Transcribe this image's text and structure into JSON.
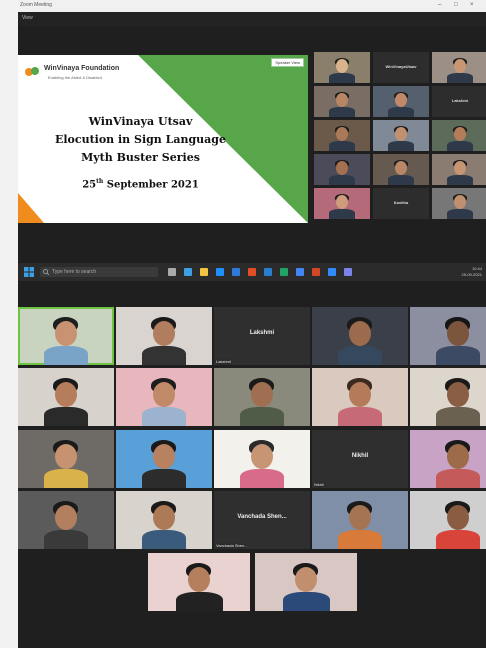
{
  "window": {
    "title": "Zoom Meeting"
  },
  "meeting_bar": {
    "label": "View"
  },
  "slide": {
    "logo": "WinVinaya Foundation",
    "logo_sub": "Enabling the Abled & Disabled",
    "tag": "Speaker View",
    "title_line1": "WinVinaya Utsav",
    "title_line2": "Elocution in Sign Language",
    "title_line3": "Myth Buster Series",
    "date_day": "25",
    "date_suffix": "th",
    "date_rest": " September 2021"
  },
  "mini_gallery": [
    {
      "label": "",
      "name": ""
    },
    {
      "label": "WinVinayaUtsav",
      "name": ""
    },
    {
      "label": "",
      "name": ""
    },
    {
      "label": "",
      "name": ""
    },
    {
      "label": "",
      "name": ""
    },
    {
      "label": "Lakshmi",
      "name": ""
    },
    {
      "label": "",
      "name": ""
    },
    {
      "label": "",
      "name": ""
    },
    {
      "label": "",
      "name": ""
    },
    {
      "label": "",
      "name": ""
    },
    {
      "label": "",
      "name": ""
    },
    {
      "label": "",
      "name": ""
    },
    {
      "label": "",
      "name": ""
    },
    {
      "label": "Kavitha",
      "name": ""
    },
    {
      "label": "",
      "name": ""
    }
  ],
  "taskbar": {
    "search_placeholder": "Type here to search",
    "time": "10:44",
    "date": "25-09-2021"
  },
  "gallery": [
    {
      "name": "",
      "label": ""
    },
    {
      "name": "",
      "label": ""
    },
    {
      "name": "Lakshmi",
      "label": "Lakshmi"
    },
    {
      "name": "",
      "label": ""
    },
    {
      "name": "",
      "label": ""
    },
    {
      "name": "",
      "label": ""
    },
    {
      "name": "",
      "label": ""
    },
    {
      "name": "",
      "label": ""
    },
    {
      "name": "",
      "label": ""
    },
    {
      "name": "",
      "label": ""
    },
    {
      "name": "",
      "label": ""
    },
    {
      "name": "",
      "label": ""
    },
    {
      "name": "",
      "label": ""
    },
    {
      "name": "Nikhil",
      "label": "Nikhil"
    },
    {
      "name": "",
      "label": ""
    },
    {
      "name": "",
      "label": ""
    },
    {
      "name": "",
      "label": ""
    },
    {
      "name": "Vanchada Shen...",
      "label": "Vanchada Shen..."
    },
    {
      "name": "",
      "label": ""
    },
    {
      "name": "",
      "label": ""
    },
    {
      "name": "",
      "label": ""
    },
    {
      "name": "",
      "label": ""
    }
  ],
  "colors": {
    "slide_green": "#57a64a",
    "slide_orange": "#f08c1e",
    "meeting_bg": "#1f1f1f",
    "active_speaker": "#6cc644"
  }
}
